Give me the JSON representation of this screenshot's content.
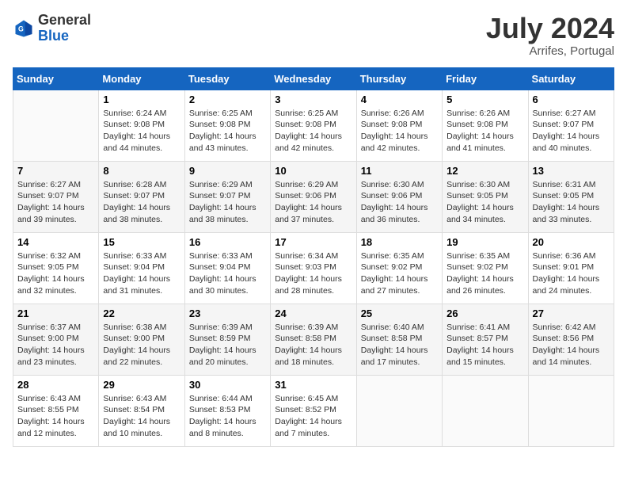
{
  "logo": {
    "general": "General",
    "blue": "Blue"
  },
  "header": {
    "month_year": "July 2024",
    "location": "Arrifes, Portugal"
  },
  "weekdays": [
    "Sunday",
    "Monday",
    "Tuesday",
    "Wednesday",
    "Thursday",
    "Friday",
    "Saturday"
  ],
  "weeks": [
    [
      {
        "day": "",
        "sunrise": "",
        "sunset": "",
        "daylight": ""
      },
      {
        "day": "1",
        "sunrise": "Sunrise: 6:24 AM",
        "sunset": "Sunset: 9:08 PM",
        "daylight": "Daylight: 14 hours and 44 minutes."
      },
      {
        "day": "2",
        "sunrise": "Sunrise: 6:25 AM",
        "sunset": "Sunset: 9:08 PM",
        "daylight": "Daylight: 14 hours and 43 minutes."
      },
      {
        "day": "3",
        "sunrise": "Sunrise: 6:25 AM",
        "sunset": "Sunset: 9:08 PM",
        "daylight": "Daylight: 14 hours and 42 minutes."
      },
      {
        "day": "4",
        "sunrise": "Sunrise: 6:26 AM",
        "sunset": "Sunset: 9:08 PM",
        "daylight": "Daylight: 14 hours and 42 minutes."
      },
      {
        "day": "5",
        "sunrise": "Sunrise: 6:26 AM",
        "sunset": "Sunset: 9:08 PM",
        "daylight": "Daylight: 14 hours and 41 minutes."
      },
      {
        "day": "6",
        "sunrise": "Sunrise: 6:27 AM",
        "sunset": "Sunset: 9:07 PM",
        "daylight": "Daylight: 14 hours and 40 minutes."
      }
    ],
    [
      {
        "day": "7",
        "sunrise": "Sunrise: 6:27 AM",
        "sunset": "Sunset: 9:07 PM",
        "daylight": "Daylight: 14 hours and 39 minutes."
      },
      {
        "day": "8",
        "sunrise": "Sunrise: 6:28 AM",
        "sunset": "Sunset: 9:07 PM",
        "daylight": "Daylight: 14 hours and 38 minutes."
      },
      {
        "day": "9",
        "sunrise": "Sunrise: 6:29 AM",
        "sunset": "Sunset: 9:07 PM",
        "daylight": "Daylight: 14 hours and 38 minutes."
      },
      {
        "day": "10",
        "sunrise": "Sunrise: 6:29 AM",
        "sunset": "Sunset: 9:06 PM",
        "daylight": "Daylight: 14 hours and 37 minutes."
      },
      {
        "day": "11",
        "sunrise": "Sunrise: 6:30 AM",
        "sunset": "Sunset: 9:06 PM",
        "daylight": "Daylight: 14 hours and 36 minutes."
      },
      {
        "day": "12",
        "sunrise": "Sunrise: 6:30 AM",
        "sunset": "Sunset: 9:05 PM",
        "daylight": "Daylight: 14 hours and 34 minutes."
      },
      {
        "day": "13",
        "sunrise": "Sunrise: 6:31 AM",
        "sunset": "Sunset: 9:05 PM",
        "daylight": "Daylight: 14 hours and 33 minutes."
      }
    ],
    [
      {
        "day": "14",
        "sunrise": "Sunrise: 6:32 AM",
        "sunset": "Sunset: 9:05 PM",
        "daylight": "Daylight: 14 hours and 32 minutes."
      },
      {
        "day": "15",
        "sunrise": "Sunrise: 6:33 AM",
        "sunset": "Sunset: 9:04 PM",
        "daylight": "Daylight: 14 hours and 31 minutes."
      },
      {
        "day": "16",
        "sunrise": "Sunrise: 6:33 AM",
        "sunset": "Sunset: 9:04 PM",
        "daylight": "Daylight: 14 hours and 30 minutes."
      },
      {
        "day": "17",
        "sunrise": "Sunrise: 6:34 AM",
        "sunset": "Sunset: 9:03 PM",
        "daylight": "Daylight: 14 hours and 28 minutes."
      },
      {
        "day": "18",
        "sunrise": "Sunrise: 6:35 AM",
        "sunset": "Sunset: 9:02 PM",
        "daylight": "Daylight: 14 hours and 27 minutes."
      },
      {
        "day": "19",
        "sunrise": "Sunrise: 6:35 AM",
        "sunset": "Sunset: 9:02 PM",
        "daylight": "Daylight: 14 hours and 26 minutes."
      },
      {
        "day": "20",
        "sunrise": "Sunrise: 6:36 AM",
        "sunset": "Sunset: 9:01 PM",
        "daylight": "Daylight: 14 hours and 24 minutes."
      }
    ],
    [
      {
        "day": "21",
        "sunrise": "Sunrise: 6:37 AM",
        "sunset": "Sunset: 9:00 PM",
        "daylight": "Daylight: 14 hours and 23 minutes."
      },
      {
        "day": "22",
        "sunrise": "Sunrise: 6:38 AM",
        "sunset": "Sunset: 9:00 PM",
        "daylight": "Daylight: 14 hours and 22 minutes."
      },
      {
        "day": "23",
        "sunrise": "Sunrise: 6:39 AM",
        "sunset": "Sunset: 8:59 PM",
        "daylight": "Daylight: 14 hours and 20 minutes."
      },
      {
        "day": "24",
        "sunrise": "Sunrise: 6:39 AM",
        "sunset": "Sunset: 8:58 PM",
        "daylight": "Daylight: 14 hours and 18 minutes."
      },
      {
        "day": "25",
        "sunrise": "Sunrise: 6:40 AM",
        "sunset": "Sunset: 8:58 PM",
        "daylight": "Daylight: 14 hours and 17 minutes."
      },
      {
        "day": "26",
        "sunrise": "Sunrise: 6:41 AM",
        "sunset": "Sunset: 8:57 PM",
        "daylight": "Daylight: 14 hours and 15 minutes."
      },
      {
        "day": "27",
        "sunrise": "Sunrise: 6:42 AM",
        "sunset": "Sunset: 8:56 PM",
        "daylight": "Daylight: 14 hours and 14 minutes."
      }
    ],
    [
      {
        "day": "28",
        "sunrise": "Sunrise: 6:43 AM",
        "sunset": "Sunset: 8:55 PM",
        "daylight": "Daylight: 14 hours and 12 minutes."
      },
      {
        "day": "29",
        "sunrise": "Sunrise: 6:43 AM",
        "sunset": "Sunset: 8:54 PM",
        "daylight": "Daylight: 14 hours and 10 minutes."
      },
      {
        "day": "30",
        "sunrise": "Sunrise: 6:44 AM",
        "sunset": "Sunset: 8:53 PM",
        "daylight": "Daylight: 14 hours and 8 minutes."
      },
      {
        "day": "31",
        "sunrise": "Sunrise: 6:45 AM",
        "sunset": "Sunset: 8:52 PM",
        "daylight": "Daylight: 14 hours and 7 minutes."
      },
      {
        "day": "",
        "sunrise": "",
        "sunset": "",
        "daylight": ""
      },
      {
        "day": "",
        "sunrise": "",
        "sunset": "",
        "daylight": ""
      },
      {
        "day": "",
        "sunrise": "",
        "sunset": "",
        "daylight": ""
      }
    ]
  ]
}
